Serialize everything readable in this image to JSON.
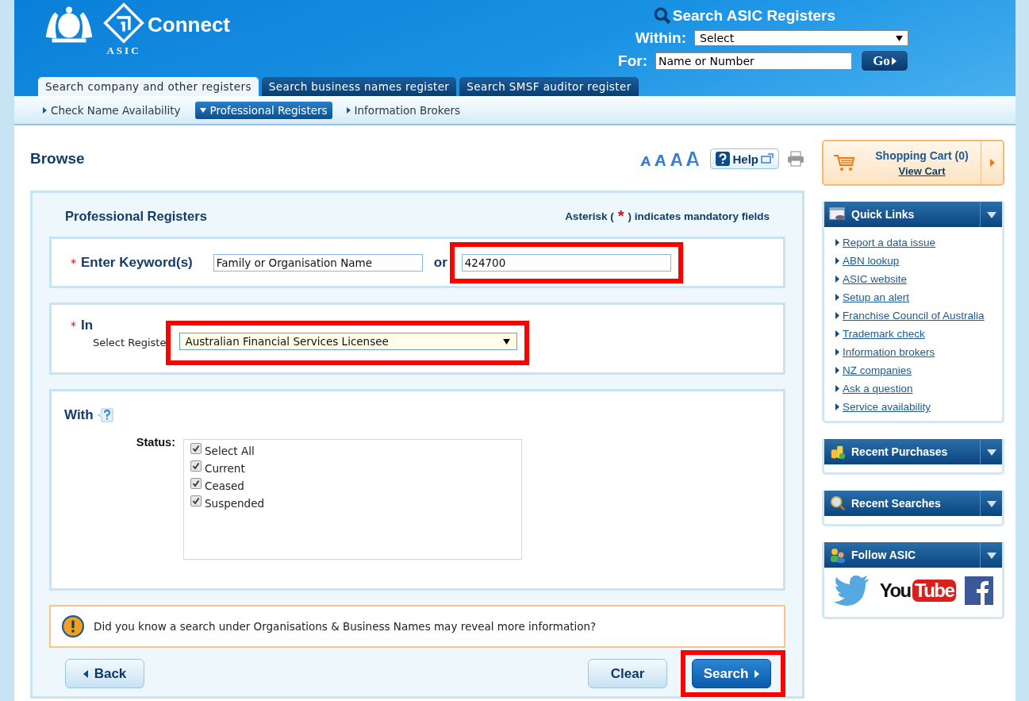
{
  "header": {
    "brand": "Connect",
    "brand_sub": "ASIC",
    "search_title": "Search ASIC Registers",
    "within_label": "Within:",
    "within_value": "Select",
    "for_label": "For:",
    "for_placeholder": "Name or Number",
    "go": "Go"
  },
  "tabs": [
    {
      "label": "Search company and other registers",
      "selected": true
    },
    {
      "label": "Search business names register",
      "selected": false
    },
    {
      "label": "Search SMSF auditor register",
      "selected": false
    }
  ],
  "subnav": [
    {
      "label": "Check Name Availability",
      "selected": false
    },
    {
      "label": "Professional Registers",
      "selected": true
    },
    {
      "label": "Information Brokers",
      "selected": false
    }
  ],
  "page_title": "Browse",
  "help": "Help",
  "form": {
    "title": "Professional Registers",
    "mandatory_note_before": "Asterisk (",
    "mandatory_star": "*",
    "mandatory_note_after": ") indicates mandatory fields",
    "keyword": {
      "star": "*",
      "label": "Enter Keyword(s)",
      "name_placeholder": "Family or Organisation Name",
      "or": "or",
      "number_value": "424700",
      "highlighted": true
    },
    "in": {
      "star": "*",
      "label": "In",
      "select_label": "Select Registe",
      "select_value": "Australian Financial Services Licensee",
      "highlighted": true
    },
    "with": {
      "label": "With",
      "status_label": "Status:",
      "statuses": [
        {
          "label": "Select All",
          "checked": true
        },
        {
          "label": "Current",
          "checked": true
        },
        {
          "label": "Ceased",
          "checked": true
        },
        {
          "label": "Suspended",
          "checked": true
        }
      ]
    },
    "info": "Did you know a search under Organisations & Business Names may reveal more information?",
    "buttons": [
      {
        "label": "Back",
        "kind": "back"
      },
      {
        "label": "Clear",
        "kind": "plain"
      },
      {
        "label": "Search",
        "kind": "primary",
        "highlighted": true
      }
    ]
  },
  "sidebar": {
    "cart_title": "Shopping Cart (0)",
    "cart_link": "View Cart",
    "panels": [
      {
        "title": "Quick Links",
        "kind": "links",
        "links": [
          "Report a data issue",
          "ABN lookup",
          "ASIC website",
          "Setup an alert",
          "Franchise Council of Australia",
          "Trademark check",
          "Information brokers",
          "NZ companies",
          "Ask a question",
          "Service availability"
        ]
      },
      {
        "title": "Recent Purchases",
        "kind": "purchases"
      },
      {
        "title": "Recent Searches",
        "kind": "searches"
      },
      {
        "title": "Follow ASIC",
        "kind": "social",
        "youtube_you": "You",
        "youtube_tube": "Tube"
      }
    ]
  }
}
